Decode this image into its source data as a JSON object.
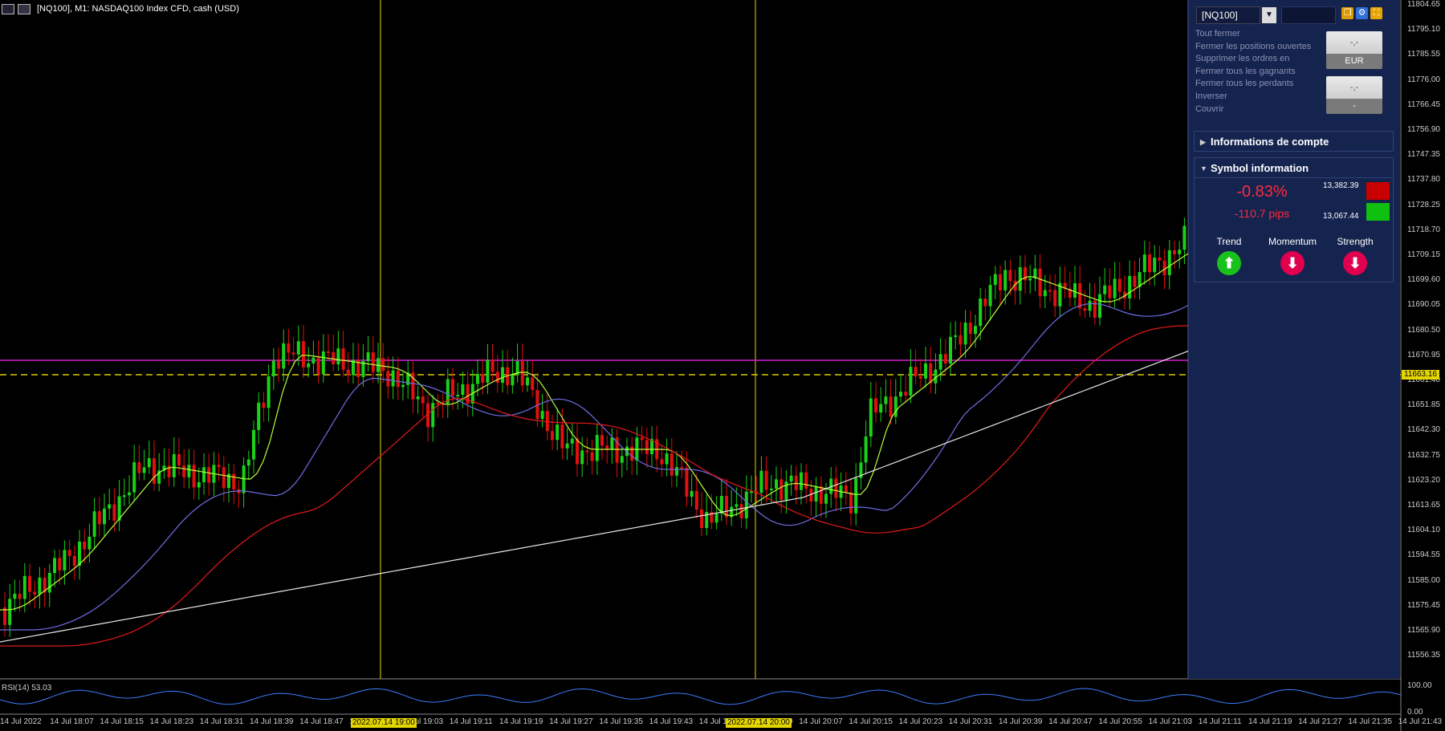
{
  "window": {
    "title": "[NQ100], M1:  NASDAQ100 Index CFD, cash (USD)"
  },
  "panel": {
    "symbol": "[NQ100]",
    "close_menu": [
      "Tout fermer",
      "Fermer les positions ouvertes",
      "Supprimer les ordres en",
      "Fermer tous les gagnants",
      "Fermer tous les perdants",
      "Inverser",
      "Couvrir"
    ],
    "btn1_top": "-,-",
    "btn1_bottom": "EUR",
    "btn2_top": "-,-",
    "btn2_bottom": "-",
    "account_title": "Informations de compte",
    "symbol_title": "Symbol information",
    "change_pct": "-0.83%",
    "change_pips": "-110.7 pips",
    "high": "13,382.39",
    "low": "13,067.44",
    "trend_label": "Trend",
    "momentum_label": "Momentum",
    "strength_label": "Strength",
    "colors": {
      "up": "#19c21a",
      "down": "#e0004f",
      "neg": "#ff2a3c",
      "bg": "#15234f"
    }
  },
  "price_axis": [
    "11804.65",
    "11795.10",
    "11785.55",
    "11776.00",
    "11766.45",
    "11756.90",
    "11747.35",
    "11737.80",
    "11728.25",
    "11718.70",
    "11709.15",
    "11699.60",
    "11690.05",
    "11680.50",
    "11670.95",
    "11661.40",
    "11651.85",
    "11642.30",
    "11632.75",
    "11623.20",
    "11613.65",
    "11604.10",
    "11594.55",
    "11585.00",
    "11575.45",
    "11565.90",
    "11556.35"
  ],
  "current_price": "11663.16",
  "time_axis": [
    "14 Jul 2022",
    "14 Jul 18:07",
    "14 Jul 18:15",
    "14 Jul 18:23",
    "14 Jul 18:31",
    "14 Jul 18:39",
    "14 Jul 18:47",
    "14 Jul 18:55",
    "14 Jul 19:03",
    "14 Jul 19:11",
    "14 Jul 19:19",
    "14 Jul 19:27",
    "14 Jul 19:35",
    "14 Jul 19:43",
    "14 Jul 19:51",
    "14 Jul 19:59",
    "14 Jul 20:07",
    "14 Jul 20:15",
    "14 Jul 20:23",
    "14 Jul 20:31",
    "14 Jul 20:39",
    "14 Jul 20:47",
    "14 Jul 20:55",
    "14 Jul 21:03",
    "14 Jul 21:11",
    "14 Jul 21:19",
    "14 Jul 21:27",
    "14 Jul 21:35",
    "14 Jul 21:43"
  ],
  "time_markers": [
    "2022.07.14 19:00",
    "2022.07.14 20:00"
  ],
  "rsi": {
    "label": "RSI(14) 53.03",
    "scale_top": "100.00",
    "scale_bottom": "0.00"
  }
}
